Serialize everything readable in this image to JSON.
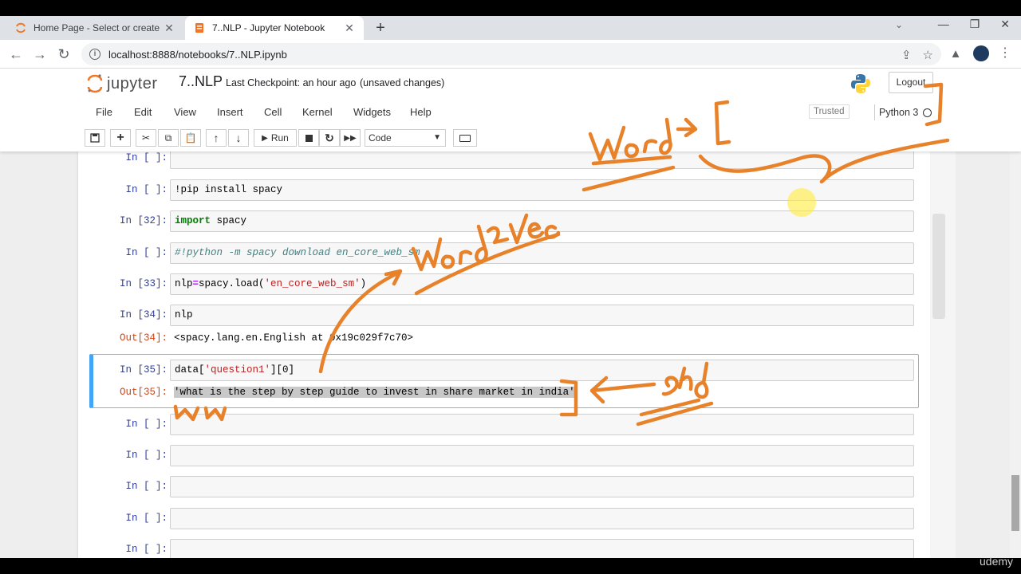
{
  "browser": {
    "tabs": [
      {
        "title": "Home Page - Select or create a n",
        "active": false
      },
      {
        "title": "7..NLP - Jupyter Notebook",
        "active": true
      }
    ],
    "url": "localhost:8888/notebooks/7..NLP.ipynb"
  },
  "jupyter": {
    "logo_text": "jupyter",
    "notebook_name": "7..NLP",
    "checkpoint": "Last Checkpoint: an hour ago",
    "save_status": "(unsaved changes)",
    "logout_label": "Logout",
    "menus": [
      "File",
      "Edit",
      "View",
      "Insert",
      "Cell",
      "Kernel",
      "Widgets",
      "Help"
    ],
    "trusted_label": "Trusted",
    "kernel_name": "Python 3",
    "run_label": "Run",
    "cell_type": "Code"
  },
  "cells": [
    {
      "prompt": "In [ ]:",
      "code": ""
    },
    {
      "prompt": "In [ ]:",
      "code": "!pip install spacy"
    },
    {
      "prompt": "In [32]:",
      "code": "import spacy"
    },
    {
      "prompt": "In [ ]:",
      "code": "#!python -m spacy download en_core_web_sm"
    },
    {
      "prompt": "In [33]:",
      "code": "nlp=spacy.load('en_core_web_sm')"
    },
    {
      "prompt": "In [34]:",
      "code": "nlp",
      "out_prompt": "Out[34]:",
      "output": "<spacy.lang.en.English at 0x19c029f7c70>"
    },
    {
      "prompt": "In [35]:",
      "code": "data['question1'][0]",
      "out_prompt": "Out[35]:",
      "output": "'what is the step by step guide to invest in share market in india'",
      "selected": true
    },
    {
      "prompt": "In [ ]:",
      "code": ""
    },
    {
      "prompt": "In [ ]:",
      "code": ""
    },
    {
      "prompt": "In [ ]:",
      "code": ""
    },
    {
      "prompt": "In [ ]:",
      "code": ""
    },
    {
      "prompt": "In [ ]:",
      "code": ""
    }
  ],
  "annotations": {
    "ink_color": "#e8822a",
    "notes": [
      "Word → [",
      "Word2Vec"
    ]
  },
  "watermark": "udemy",
  "colors": {
    "selected_cell_bar": "#42a5f5",
    "in_prompt": "#303f9f",
    "out_prompt": "#d84315"
  }
}
